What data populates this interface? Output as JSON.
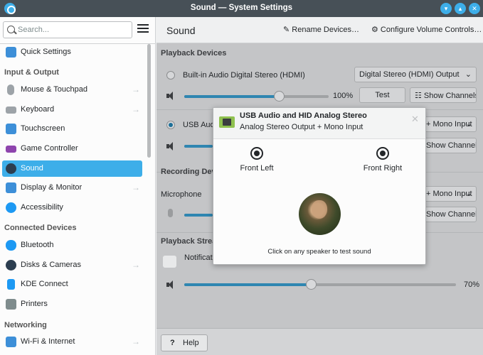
{
  "window": {
    "title": "Sound — System Settings"
  },
  "sidebar": {
    "search_placeholder": "Search...",
    "items": [
      {
        "label": "Quick Settings",
        "icon": "quick-settings-icon"
      },
      {
        "label": "Mouse & Touchpad",
        "icon": "mouse-icon"
      },
      {
        "label": "Keyboard",
        "icon": "keyboard-icon"
      },
      {
        "label": "Touchscreen",
        "icon": "touchscreen-icon"
      },
      {
        "label": "Game Controller",
        "icon": "game-controller-icon"
      },
      {
        "label": "Sound",
        "icon": "speaker-icon"
      },
      {
        "label": "Display & Monitor",
        "icon": "display-icon"
      },
      {
        "label": "Accessibility",
        "icon": "accessibility-icon"
      },
      {
        "label": "Bluetooth",
        "icon": "bluetooth-icon"
      },
      {
        "label": "Disks & Cameras",
        "icon": "disk-icon"
      },
      {
        "label": "KDE Connect",
        "icon": "kde-connect-icon"
      },
      {
        "label": "Printers",
        "icon": "printer-icon"
      },
      {
        "label": "Wi-Fi & Internet",
        "icon": "wifi-icon"
      }
    ],
    "sections": {
      "input_output": "Input & Output",
      "connected_devices": "Connected Devices",
      "networking": "Networking"
    }
  },
  "main": {
    "title": "Sound",
    "rename_devices": "Rename Devices…",
    "configure_volume": "Configure Volume Controls…",
    "playback_devices": "Playback Devices",
    "device1_name": "Built-in Audio Digital Stereo (HDMI)",
    "device1_profile": "Digital Stereo (HDMI) Output",
    "device1_volume": "100%",
    "test": "Test",
    "show_channels": "Show Channels",
    "device2_name": "USB Audi",
    "mono_input": "+ Mono Input",
    "recording_devices": "Recording Devi",
    "microphone": "Microphone",
    "playback_streams": "Playback Strea",
    "notification": "Notificati",
    "stream_volume": "70%",
    "help": "Help"
  },
  "popup": {
    "title": "USB Audio and HID Analog Stereo",
    "subtitle": "Analog Stereo Output + Mono Input",
    "front_left": "Front Left",
    "front_right": "Front Right",
    "hint": "Click on any speaker to test sound"
  },
  "colors": {
    "accent": "#3daee9",
    "titlebar": "#475057"
  }
}
